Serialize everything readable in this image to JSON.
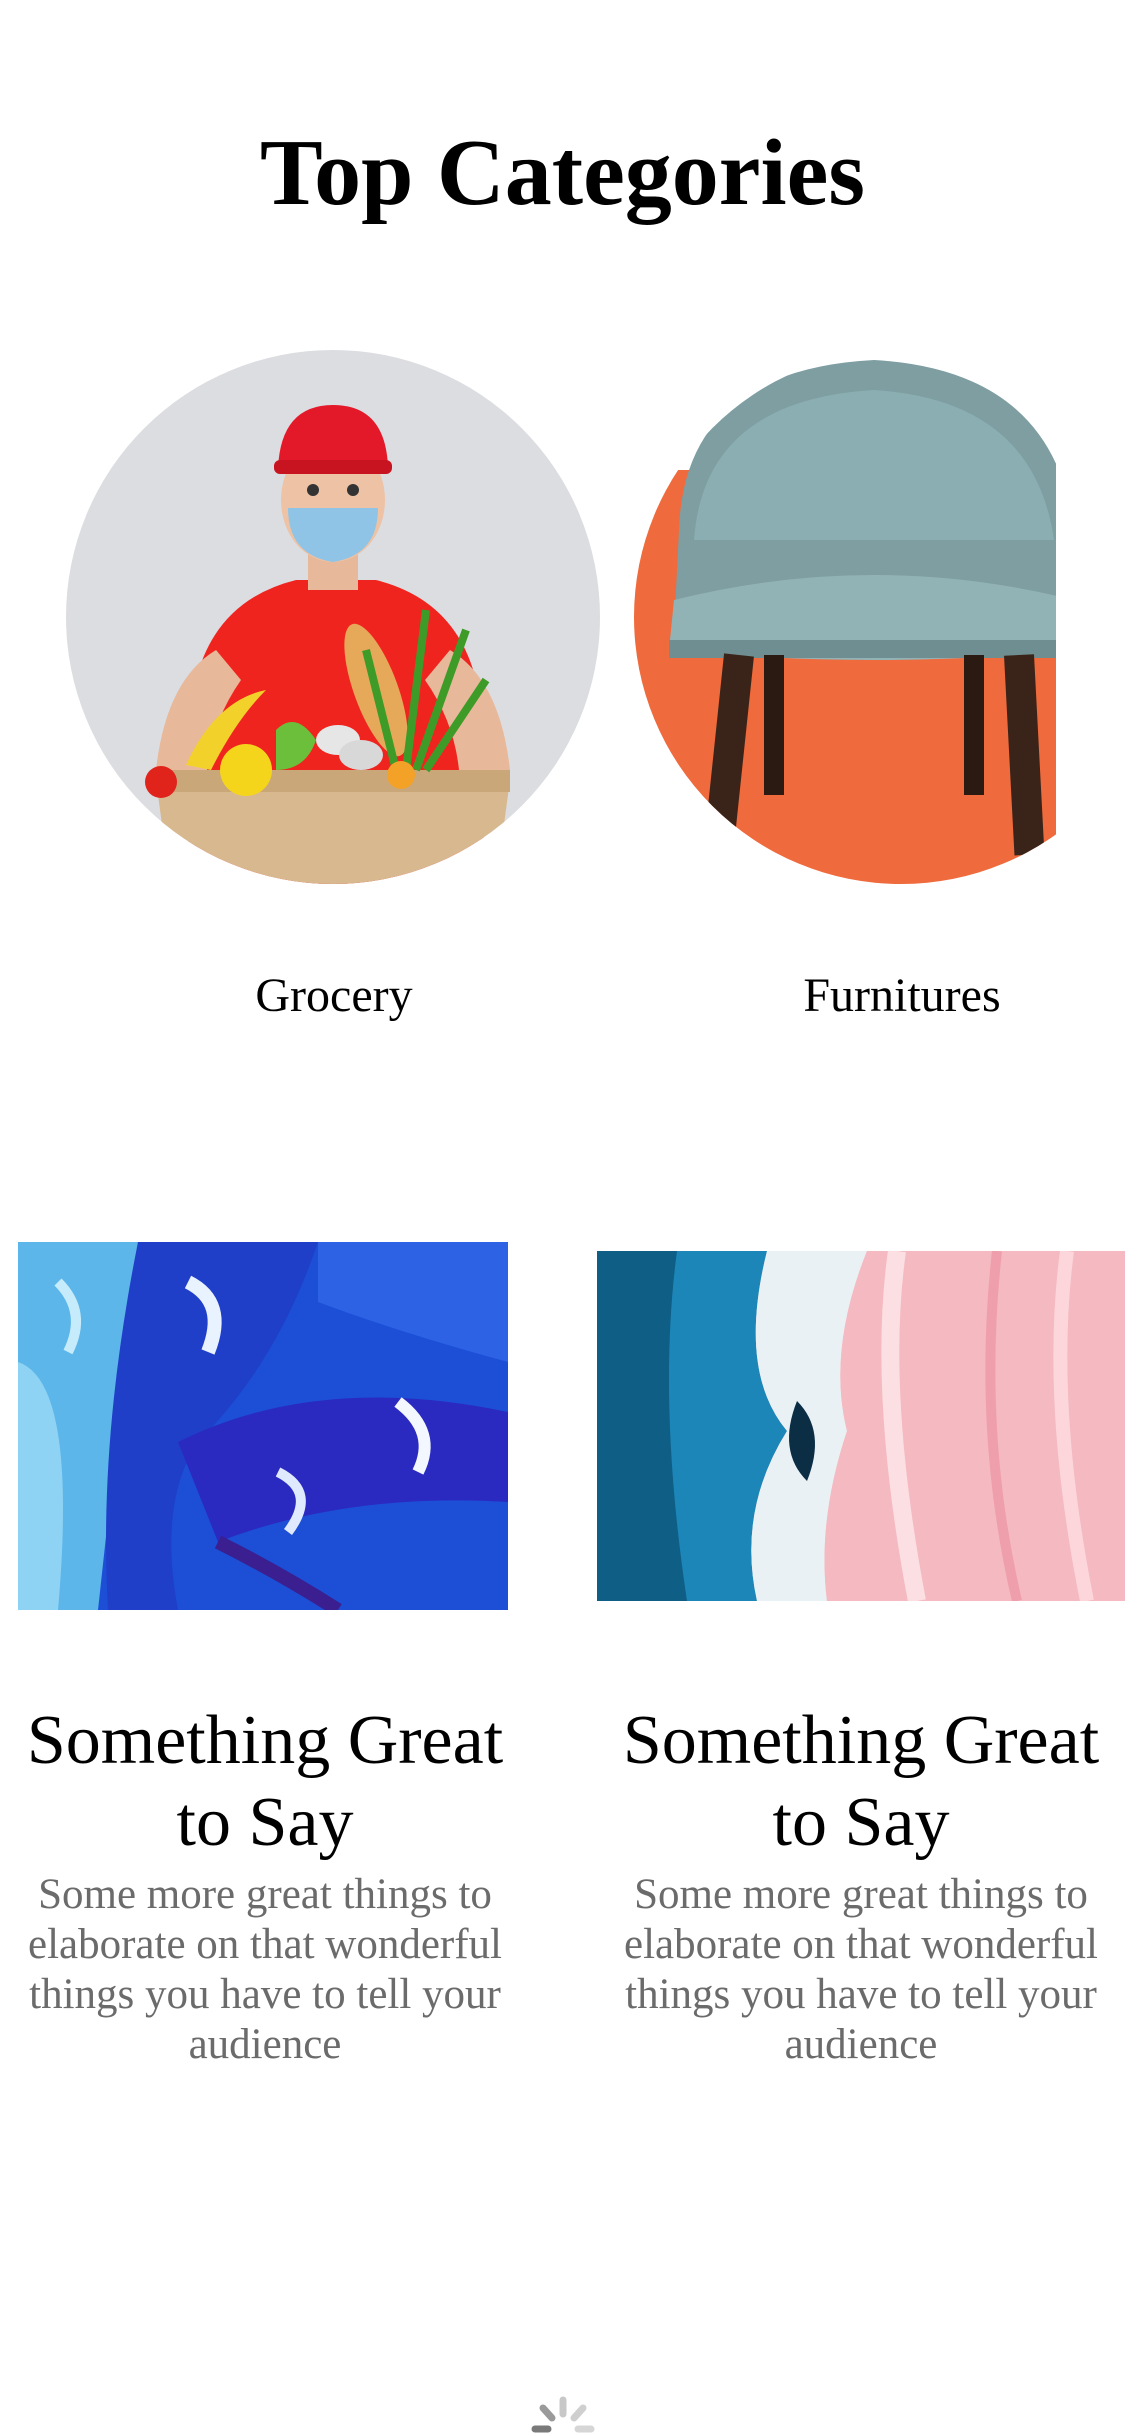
{
  "page": {
    "title": "Top Categories"
  },
  "categories": [
    {
      "label": "Grocery",
      "image": "delivery-person-with-grocery-box"
    },
    {
      "label": "Furnitures",
      "image": "grey-armchair-on-orange"
    }
  ],
  "cards": [
    {
      "title": "Something Great to Say",
      "body": "Some more great things to elaborate on that wonderful things you have to tell your audience",
      "image": "blue-abstract-paint"
    },
    {
      "title": "Something Great to Say",
      "body": "Some more great things to elaborate on that wonderful things you have to tell your audience",
      "image": "blue-pink-abstract-paint"
    }
  ],
  "loading_indicator": "spinner-icon",
  "colors": {
    "text": "#000000",
    "body_text": "#6b6b6b",
    "furniture_bg": "#ef6a3c",
    "grocery_bg": "#dcdde1"
  }
}
